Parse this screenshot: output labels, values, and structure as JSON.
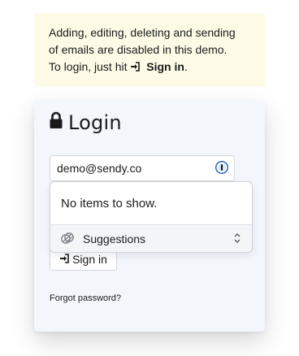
{
  "notice": {
    "line1": "Adding, editing, deleting and sending",
    "line2": "of emails are disabled in this demo.",
    "line3_prefix": "To login, just hit",
    "line3_action": "Sign in",
    "line3_suffix": ".",
    "background": "#fdfbe6"
  },
  "login": {
    "title": "Login",
    "email_value": "demo@sendy.co",
    "signin_label": "Sign in",
    "forgot_label": "Forgot password?"
  },
  "autofill": {
    "empty_message": "No items to show.",
    "suggestions_label": "Suggestions",
    "accent": "#1a5cc8"
  },
  "icons": {
    "title": "lock-icon",
    "email_field": "password-manager-icon",
    "signin": "sign-in-icon",
    "suggestions": "suggestions-icon",
    "toggle": "chevron-up-down-icon"
  }
}
